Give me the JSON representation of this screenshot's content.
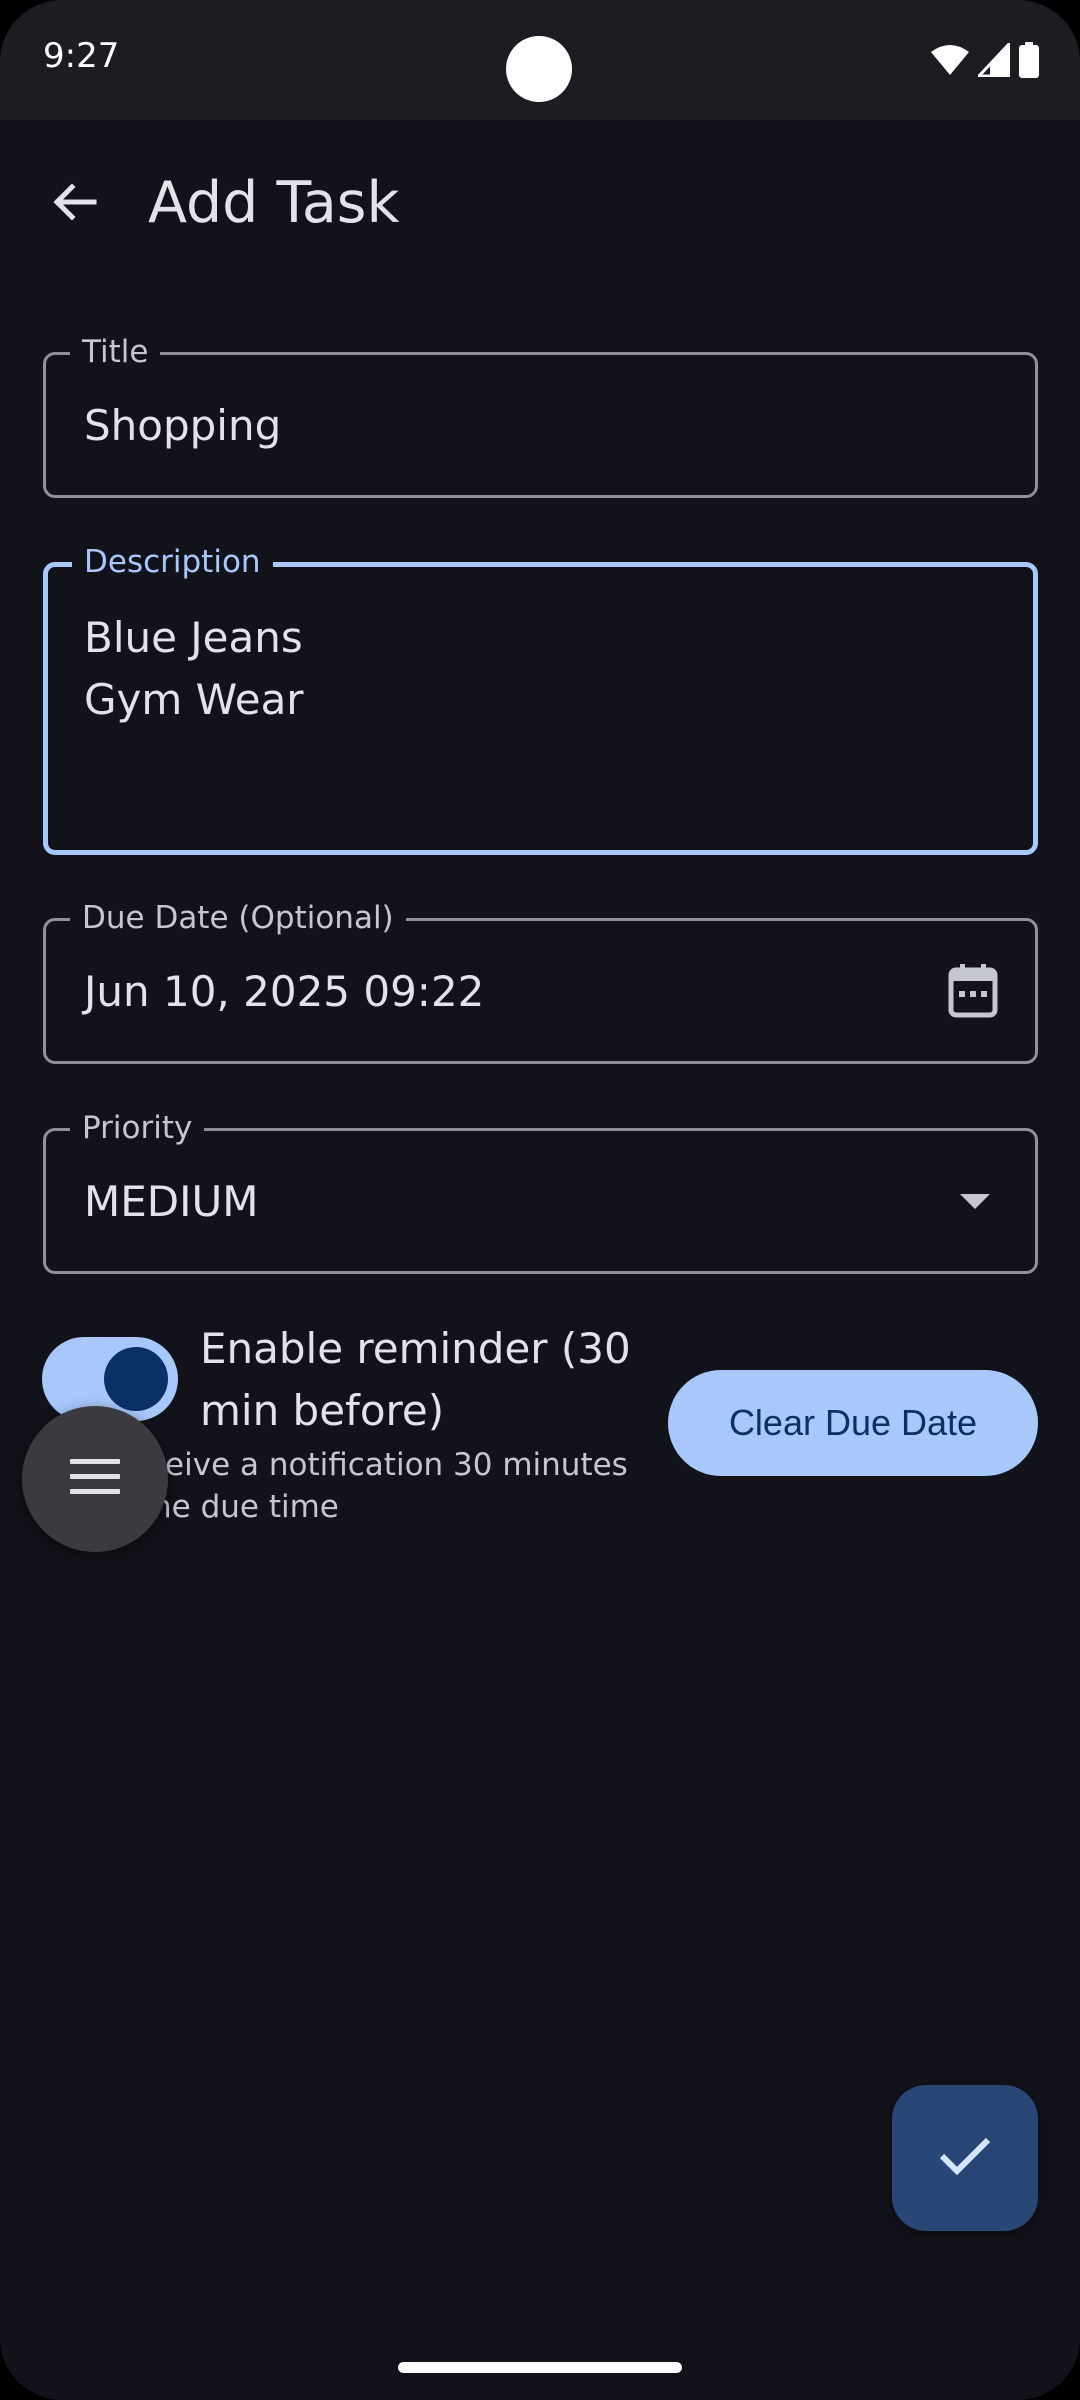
{
  "status_bar": {
    "time": "9:27",
    "icons": [
      "wifi-icon",
      "signal-icon",
      "battery-icon"
    ]
  },
  "app_bar": {
    "back_icon": "arrow-back-icon",
    "title": "Add Task"
  },
  "form": {
    "title": {
      "label": "Title",
      "value": "Shopping"
    },
    "description": {
      "label": "Description",
      "value": "Blue Jeans\nGym Wear",
      "focused": true
    },
    "due_date": {
      "label": "Due Date (Optional)",
      "value": "Jun 10, 2025 09:22",
      "icon": "calendar-icon"
    },
    "priority": {
      "label": "Priority",
      "value": "MEDIUM",
      "icon": "dropdown-arrow-icon"
    }
  },
  "reminder": {
    "enabled": true,
    "title": "Enable reminder (30 min before)",
    "description_line1": "ceive a notification 30 minutes",
    "description_line2": "he due time"
  },
  "clear_due_date_label": "Clear Due Date",
  "menu_bubble_icon": "menu-icon",
  "save_fab_icon": "check-icon",
  "colors": {
    "background": "#12131a",
    "status_bar": "#1c1c22",
    "accent": "#a8c7fa",
    "on_accent": "#0a3068",
    "fab": "#284777",
    "outline": "#8e909a"
  }
}
